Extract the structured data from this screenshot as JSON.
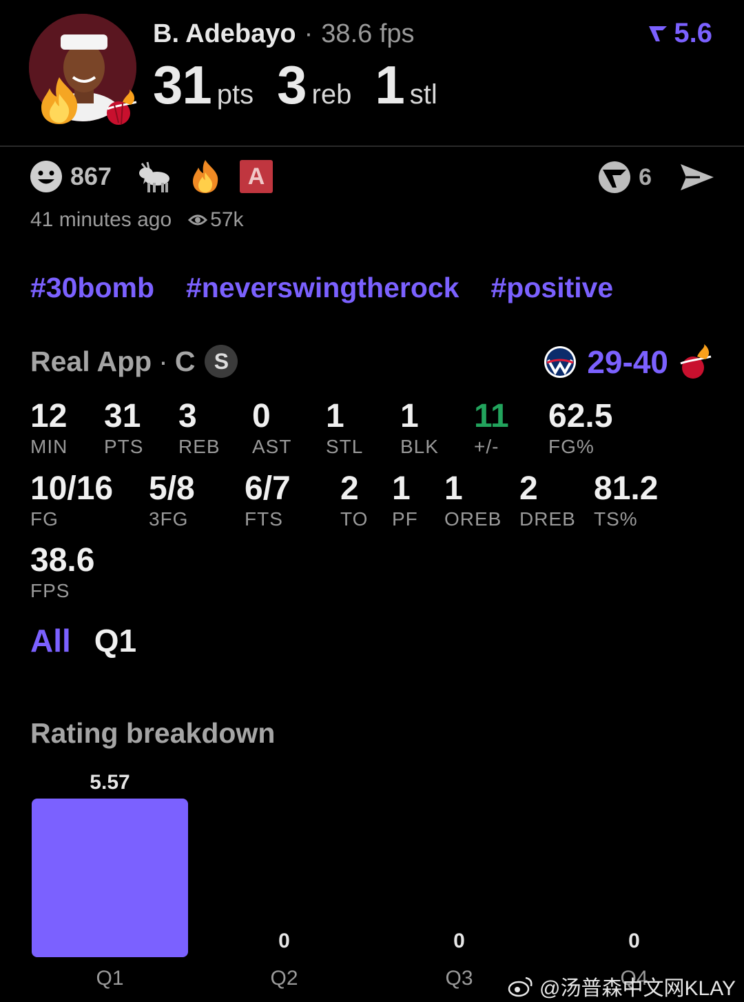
{
  "header": {
    "player_name": "B. Adebayo",
    "separator": "·",
    "fps_text": "38.6 fps",
    "rating": "5.6",
    "pts_value": "31",
    "pts_unit": "pts",
    "reb_value": "3",
    "reb_unit": "reb",
    "stl_value": "1",
    "stl_unit": "stl"
  },
  "reactions": {
    "smile_count": "867",
    "comment_count": "6",
    "badge_letter": "A"
  },
  "meta": {
    "time_ago": "41 minutes ago",
    "views": "57k"
  },
  "hashtags": [
    "#30bomb",
    "#neverswingtherock",
    "#positive"
  ],
  "game": {
    "app_name": "Real App",
    "separator": "·",
    "position": "C",
    "starter_badge": "S",
    "score": "29-40"
  },
  "stats_row1": [
    {
      "value": "12",
      "label": "MIN"
    },
    {
      "value": "31",
      "label": "PTS"
    },
    {
      "value": "3",
      "label": "REB"
    },
    {
      "value": "0",
      "label": "AST"
    },
    {
      "value": "1",
      "label": "STL"
    },
    {
      "value": "1",
      "label": "BLK"
    },
    {
      "value": "11",
      "label": "+/-"
    },
    {
      "value": "62.5",
      "label": "FG%"
    }
  ],
  "stats_row2": [
    {
      "value": "10/16",
      "label": "FG"
    },
    {
      "value": "5/8",
      "label": "3FG"
    },
    {
      "value": "6/7",
      "label": "FTS"
    },
    {
      "value": "2",
      "label": "TO"
    },
    {
      "value": "1",
      "label": "PF"
    },
    {
      "value": "1",
      "label": "OREB"
    },
    {
      "value": "2",
      "label": "DREB"
    },
    {
      "value": "81.2",
      "label": "TS%"
    }
  ],
  "stats_row3": [
    {
      "value": "38.6",
      "label": "FPS"
    }
  ],
  "tabs": {
    "all": "All",
    "q1": "Q1"
  },
  "section_title": "Rating breakdown",
  "chart_data": {
    "type": "bar",
    "categories": [
      "Q1",
      "Q2",
      "Q3",
      "Q4"
    ],
    "values": [
      5.57,
      0,
      0,
      0
    ],
    "value_labels": [
      "5.57",
      "0",
      "0",
      "0"
    ],
    "title": "Rating breakdown",
    "xlabel": "",
    "ylabel": "",
    "ylim": [
      0,
      5.57
    ],
    "grid": false,
    "bar_color": "#7b61ff"
  },
  "watermark": "@汤普森中文网KLAY",
  "colors": {
    "accent": "#7b61ff",
    "positive": "#22a45d",
    "heat_red": "#c8102e",
    "background": "#000000"
  }
}
